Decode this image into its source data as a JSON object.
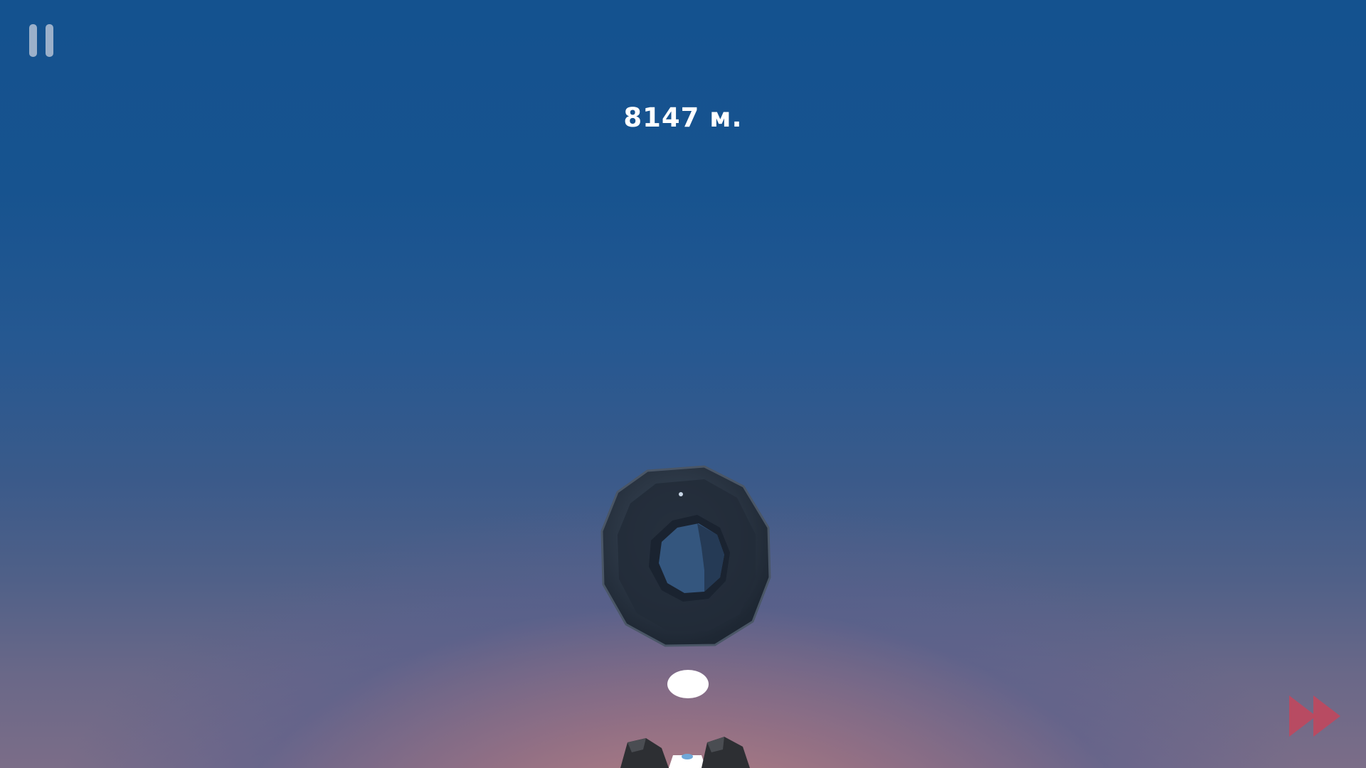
{
  "hud": {
    "pause_icon": "pause-icon",
    "distance_text": "8147 м.",
    "fast_forward_icon": "fast-forward-icon"
  },
  "scene": {
    "obstacle": "tire-ring",
    "player": "white-ball",
    "launcher": "rocky-launcher"
  },
  "colors": {
    "sky_top": "#14528f",
    "horizon_glow": "#c48680",
    "hud_text": "#ffffff",
    "pause_icon": "#a7b8cf",
    "fast_forward": "#c0485e"
  }
}
